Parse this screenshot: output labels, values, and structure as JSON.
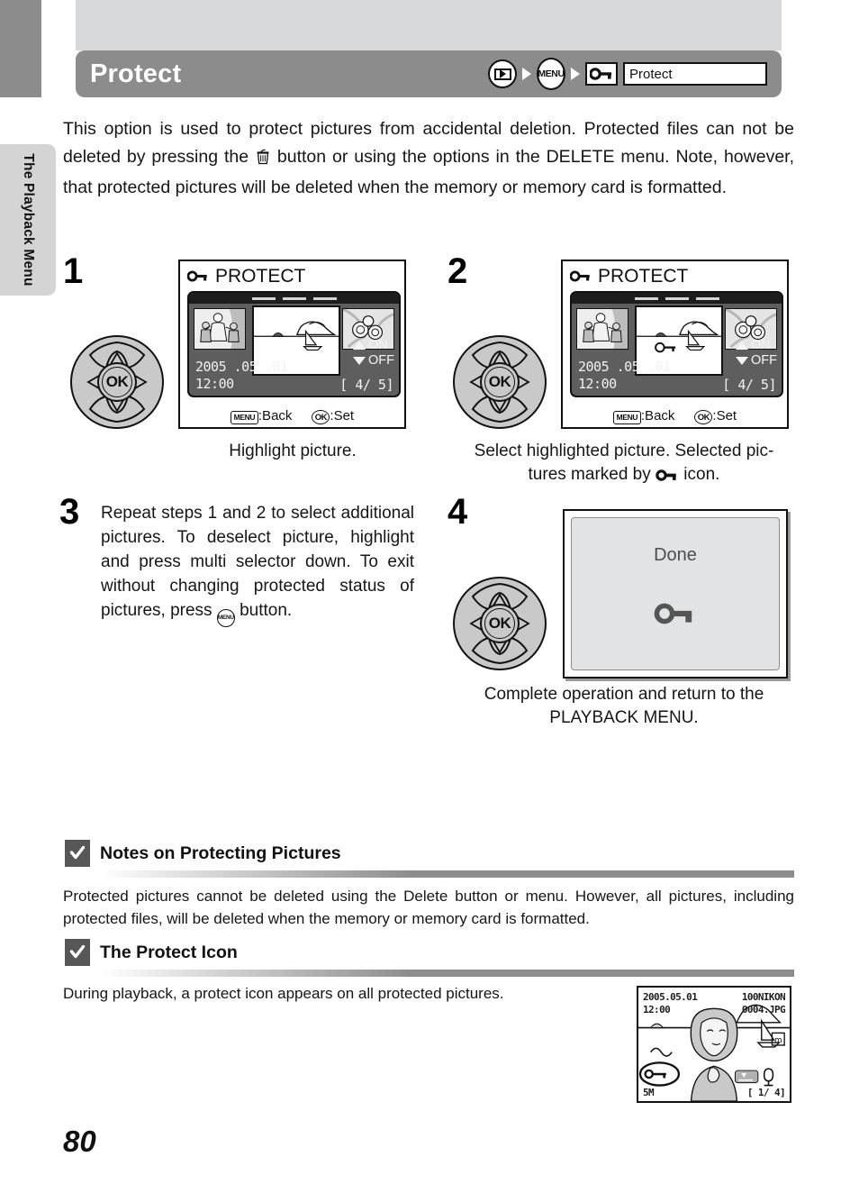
{
  "chapter_tab": {
    "label": "The Playback Menu"
  },
  "header": {
    "title": "Protect",
    "breadcrumb": {
      "playback_icon": "playback-button-icon",
      "menu_icon": "menu-button-icon",
      "key_icon": "protect-key-icon",
      "field_value": "Protect"
    }
  },
  "intro": {
    "part1": "This option is used to protect pictures from accidental deletion. Protected files can not be deleted by pressing the ",
    "trash_icon": "trash-can-icon",
    "part2": " button or using the options in the DELETE menu. Note, however, that protected pictures will be deleted when the memory or memory card is formatted."
  },
  "steps": [
    {
      "number": "1",
      "caption": "Highlight picture."
    },
    {
      "number": "2",
      "caption_line1": "Select highlighted picture. Selected pic-",
      "caption_line2_pre": "tures marked by ",
      "caption_line2_post": " icon."
    },
    {
      "number": "3",
      "body_pre": "Repeat steps 1 and 2 to select additional pictures. To deselect picture, highlight and press multi selector down. To exit without changing protected status of pictures, press ",
      "body_post": " button."
    },
    {
      "number": "4",
      "caption_line1": "Complete operation and return to the",
      "caption_line2": "PLAYBACK MENU."
    }
  ],
  "lcd1": {
    "title": "PROTECT",
    "date": "2005 .05 .01",
    "time": "12:00",
    "counter": "[   4/   5]",
    "on_label": "ON",
    "off_label": "OFF",
    "footer_menu_badge": "MENU",
    "footer_menu_text": ":Back",
    "footer_ok_badge": "OK",
    "footer_ok_text": ":Set",
    "thumb_left": "family-photo-thumbnail",
    "thumb_main": "sailboat-landscape-thumbnail",
    "thumb_right": "flowers-thumbnail"
  },
  "lcd2": {
    "title": "PROTECT",
    "date": "2005 .05 .01",
    "time": "12:00",
    "counter": "[   4/   5]",
    "on_label": "ON",
    "off_label": "OFF",
    "footer_menu_badge": "MENU",
    "footer_menu_text": ":Back",
    "footer_ok_badge": "OK",
    "footer_ok_text": ":Set",
    "protect_marker": "protect-key-icon"
  },
  "done_panel": {
    "text": "Done",
    "icon": "protect-key-icon"
  },
  "notes": [
    {
      "title": "Notes on Protecting Pictures",
      "body": "Protected pictures cannot be deleted using the Delete button or menu. However, all pictures, including protected files, will be deleted when the memory or memory card is formatted."
    },
    {
      "title": "The Protect Icon",
      "body": "During playback, a protect icon appears on all protected pictures."
    }
  ],
  "playback_sample": {
    "date": "2005.05.01",
    "time": "12:00",
    "folder": "100NIKON",
    "filename": "0004.JPG",
    "quality": "5M",
    "frame_counter": "[    1/    4]",
    "protect_icon": "protect-key-icon"
  },
  "page_number": "80",
  "colors": {
    "title_bar": "#8c8c8c",
    "top_band": "#d7d9db",
    "chapter_tab": "#d4d4d4",
    "side_tab": "#8c8c8c",
    "lcd_screen": "#5e5e5e",
    "note_check": "#575757",
    "done_panel": "#e2e3e4"
  }
}
